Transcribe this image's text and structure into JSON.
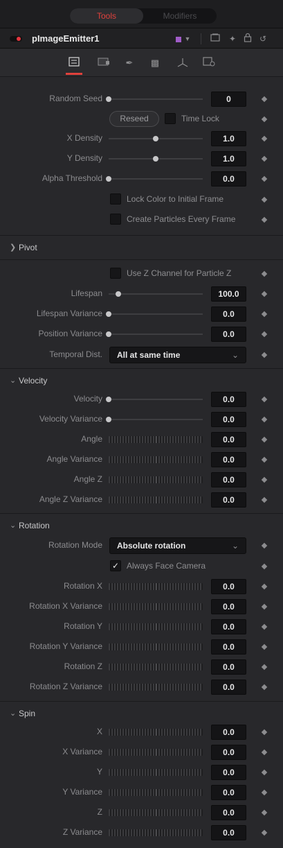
{
  "tabs": {
    "tools": "Tools",
    "modifiers": "Modifiers"
  },
  "header": {
    "node_name": "pImageEmitter1"
  },
  "emitter": {
    "random_seed": {
      "label": "Random Seed",
      "value": "0",
      "position": 0.0
    },
    "reseed_label": "Reseed",
    "time_lock_label": "Time Lock",
    "x_density": {
      "label": "X Density",
      "value": "1.0",
      "position": 0.5
    },
    "y_density": {
      "label": "Y Density",
      "value": "1.0",
      "position": 0.5
    },
    "alpha_threshold": {
      "label": "Alpha Threshold",
      "value": "0.0",
      "position": 0.0
    },
    "lock_color_label": "Lock Color to Initial Frame",
    "create_particles_label": "Create Particles Every Frame"
  },
  "pivot": {
    "title": "Pivot"
  },
  "lifespan_block": {
    "use_z_label": "Use Z Channel for Particle Z",
    "lifespan": {
      "label": "Lifespan",
      "value": "100.0",
      "position": 0.1
    },
    "lifespan_variance": {
      "label": "Lifespan Variance",
      "value": "0.0",
      "position": 0.0
    },
    "position_variance": {
      "label": "Position Variance",
      "value": "0.0",
      "position": 0.0
    },
    "temporal_label": "Temporal Dist.",
    "temporal_value": "All at same time"
  },
  "velocity": {
    "title": "Velocity",
    "velocity": {
      "label": "Velocity",
      "value": "0.0",
      "position": 0.0
    },
    "velocity_variance": {
      "label": "Velocity Variance",
      "value": "0.0",
      "position": 0.0
    },
    "angle": {
      "label": "Angle",
      "value": "0.0"
    },
    "angle_variance": {
      "label": "Angle Variance",
      "value": "0.0"
    },
    "angle_z": {
      "label": "Angle Z",
      "value": "0.0"
    },
    "angle_z_variance": {
      "label": "Angle Z Variance",
      "value": "0.0"
    }
  },
  "rotation": {
    "title": "Rotation",
    "mode_label": "Rotation Mode",
    "mode_value": "Absolute rotation",
    "face_camera_label": "Always Face Camera",
    "face_camera_checked": true,
    "rot_x": {
      "label": "Rotation X",
      "value": "0.0"
    },
    "rot_x_var": {
      "label": "Rotation X Variance",
      "value": "0.0"
    },
    "rot_y": {
      "label": "Rotation Y",
      "value": "0.0"
    },
    "rot_y_var": {
      "label": "Rotation Y Variance",
      "value": "0.0"
    },
    "rot_z": {
      "label": "Rotation Z",
      "value": "0.0"
    },
    "rot_z_var": {
      "label": "Rotation Z Variance",
      "value": "0.0"
    }
  },
  "spin": {
    "title": "Spin",
    "x": {
      "label": "X",
      "value": "0.0"
    },
    "x_var": {
      "label": "X Variance",
      "value": "0.0"
    },
    "y": {
      "label": "Y",
      "value": "0.0"
    },
    "y_var": {
      "label": "Y Variance",
      "value": "0.0"
    },
    "z": {
      "label": "Z",
      "value": "0.0"
    },
    "z_var": {
      "label": "Z Variance",
      "value": "0.0"
    }
  },
  "icons": {
    "expanded": "chevron-down-icon",
    "collapsed": "chevron-right-icon",
    "keyframe": "keyframe-diamond-icon"
  },
  "colors": {
    "accent": "#e0413c",
    "node_color": "#a05cc8"
  }
}
